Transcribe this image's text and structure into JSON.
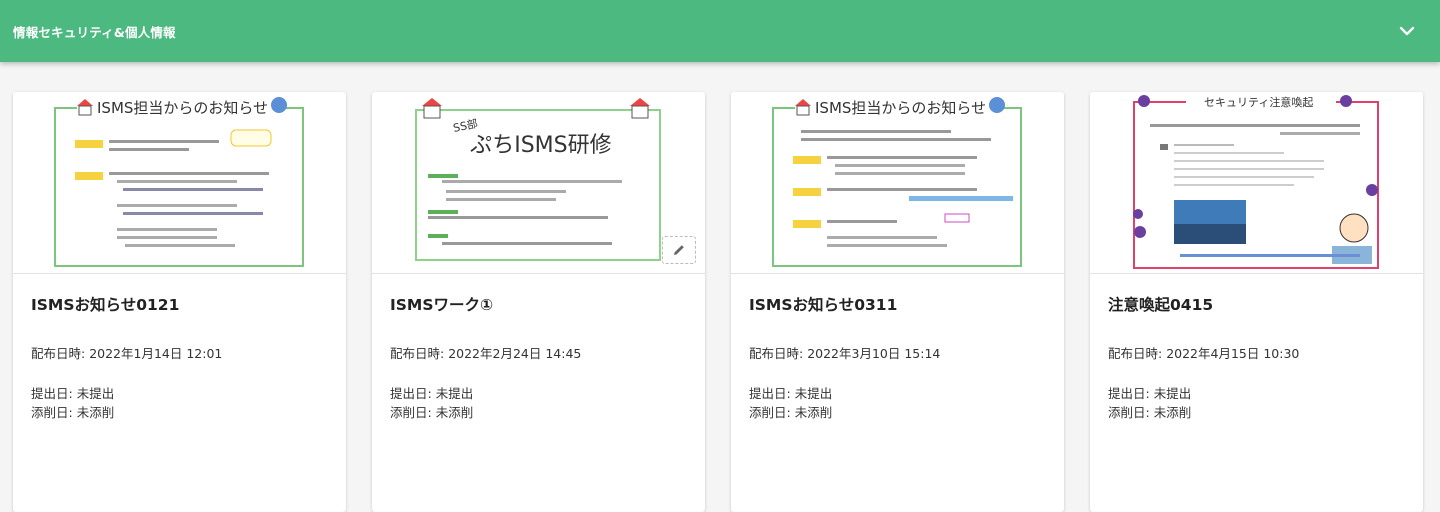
{
  "header": {
    "title": "情報セキュリティ&個人情報"
  },
  "labels": {
    "distributed_prefix": "配布日時: ",
    "submitted_prefix": "提出日: ",
    "corrected_prefix": "添削日: "
  },
  "cards": [
    {
      "title": "ISMSお知らせ0121",
      "distributed": "2022年1月14日 12:01",
      "submitted": "未提出",
      "corrected": "未添削",
      "thumb_heading": "ISMS担当からのお知らせ"
    },
    {
      "title": "ISMSワーク①",
      "distributed": "2022年2月24日 14:45",
      "submitted": "未提出",
      "corrected": "未添削",
      "thumb_heading": "ぷちISMS研修",
      "thumb_sub": "SS部"
    },
    {
      "title": "ISMSお知らせ0311",
      "distributed": "2022年3月10日 15:14",
      "submitted": "未提出",
      "corrected": "未添削",
      "thumb_heading": "ISMS担当からのお知らせ"
    },
    {
      "title": "注意喚起0415",
      "distributed": "2022年4月15日 10:30",
      "submitted": "未提出",
      "corrected": "未添削",
      "thumb_heading": "セキュリティ注意喚起"
    }
  ],
  "colors": {
    "header_bg": "#4cb981",
    "header_text": "#ffffff",
    "thumb_green": "#6fc070",
    "thumb_red": "#e0406a",
    "thumb_yellow": "#f7d23e"
  }
}
